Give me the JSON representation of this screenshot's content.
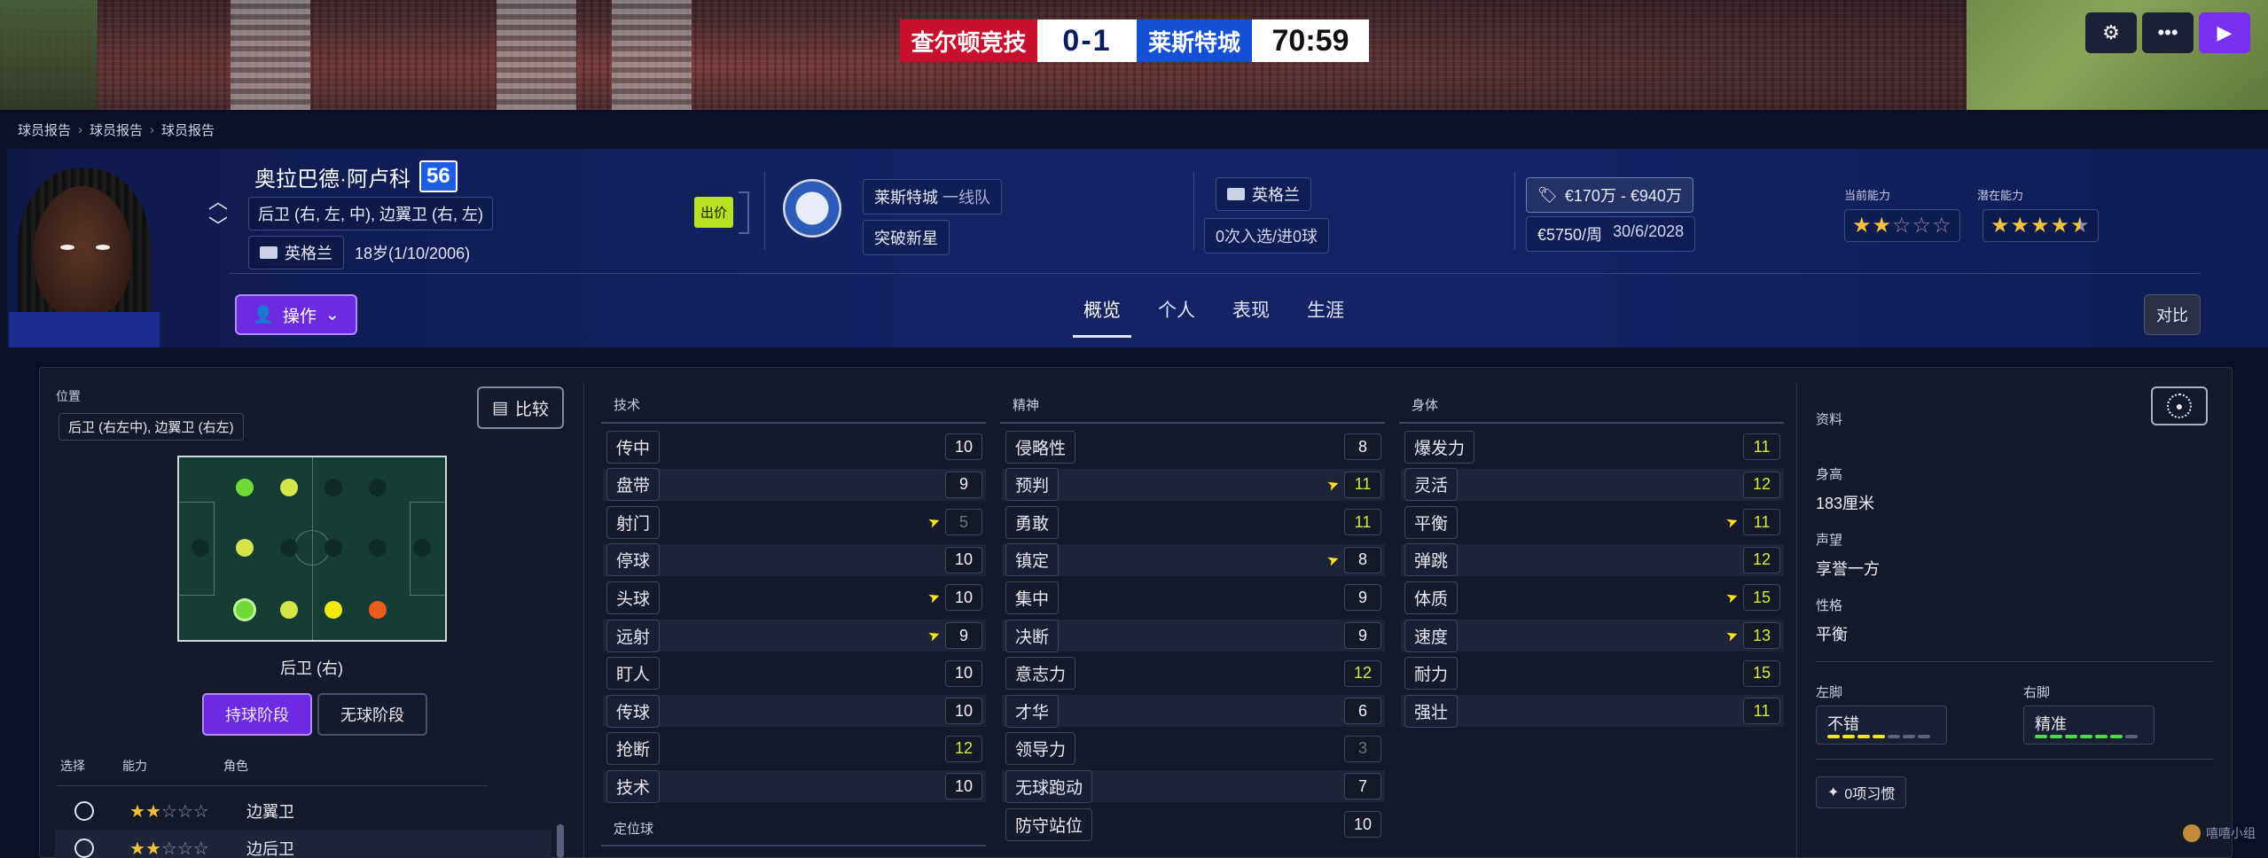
{
  "match": {
    "home_team": "查尔顿竞技",
    "score": "0-1",
    "away_team": "莱斯特城",
    "time": "70:59",
    "home_color": "#c8102e",
    "away_color": "#1450d6"
  },
  "top_buttons": [
    {
      "icon": "gear-icon"
    },
    {
      "icon": "more-icon"
    },
    {
      "icon": "play-icon"
    }
  ],
  "breadcrumb": [
    "球员报告",
    "球员报告",
    "球员报告"
  ],
  "player": {
    "name": "奥拉巴德·阿卢科",
    "rating": "56",
    "positions": "后卫 (右, 左, 中), 边翼卫 (右, 左)",
    "nationality": "英格兰",
    "age_dob": "18岁(1/10/2006)",
    "sale_tag": "出价",
    "club": "莱斯特城",
    "squad": "一线队",
    "role_tag": "突破新星",
    "intl_nation": "英格兰",
    "intl_caps": "0次入选/进0球",
    "value": "€170万 - €940万",
    "wage": "€5750/周",
    "contract_end": "30/6/2028",
    "current_ability_label": "当前能力",
    "potential_ability_label": "潜在能力",
    "current_ability_stars": 2,
    "potential_ability_stars": 4.5
  },
  "actions": {
    "action_label": "操作",
    "compare_top_label": "对比"
  },
  "tabs": [
    {
      "label": "概览",
      "active": true
    },
    {
      "label": "个人",
      "active": false
    },
    {
      "label": "表现",
      "active": false
    },
    {
      "label": "生涯",
      "active": false
    }
  ],
  "position_panel": {
    "title": "位置",
    "positions_chip": "后卫 (右左中), 边翼卫 (右左)",
    "compare_label": "比较",
    "selected_position": "后卫 (右)",
    "phase_in_possession": "持球阶段",
    "phase_out_possession": "无球阶段",
    "role_headers": [
      "选择",
      "能力",
      "角色"
    ],
    "roles": [
      {
        "name": "边翼卫",
        "stars": 2
      },
      {
        "name": "边后卫",
        "stars": 2
      }
    ]
  },
  "technical": {
    "title": "技术",
    "attrs": [
      {
        "name": "传中",
        "value": "10",
        "tone": "white"
      },
      {
        "name": "盘带",
        "value": "9",
        "tone": "white"
      },
      {
        "name": "射门",
        "value": "5",
        "tone": "dim",
        "trend": "arrow-icon"
      },
      {
        "name": "停球",
        "value": "10",
        "tone": "white"
      },
      {
        "name": "头球",
        "value": "10",
        "tone": "white",
        "trend": "arrow-icon"
      },
      {
        "name": "远射",
        "value": "9",
        "tone": "white",
        "trend": "arrow-icon"
      },
      {
        "name": "盯人",
        "value": "10",
        "tone": "white"
      },
      {
        "name": "传球",
        "value": "10",
        "tone": "white"
      },
      {
        "name": "抢断",
        "value": "12",
        "tone": "yellow"
      },
      {
        "name": "技术",
        "value": "10",
        "tone": "white"
      }
    ],
    "setpiece_title": "定位球"
  },
  "mental": {
    "title": "精神",
    "attrs": [
      {
        "name": "侵略性",
        "value": "8",
        "tone": "white"
      },
      {
        "name": "预判",
        "value": "11",
        "tone": "yellow",
        "trend": "arrow-icon"
      },
      {
        "name": "勇敢",
        "value": "11",
        "tone": "yellow"
      },
      {
        "name": "镇定",
        "value": "8",
        "tone": "white",
        "trend": "arrow-icon"
      },
      {
        "name": "集中",
        "value": "9",
        "tone": "white"
      },
      {
        "name": "决断",
        "value": "9",
        "tone": "white"
      },
      {
        "name": "意志力",
        "value": "12",
        "tone": "yellow"
      },
      {
        "name": "才华",
        "value": "6",
        "tone": "white"
      },
      {
        "name": "领导力",
        "value": "3",
        "tone": "dim"
      },
      {
        "name": "无球跑动",
        "value": "7",
        "tone": "white"
      },
      {
        "name": "防守站位",
        "value": "10",
        "tone": "white"
      }
    ]
  },
  "physical": {
    "title": "身体",
    "attrs": [
      {
        "name": "爆发力",
        "value": "11",
        "tone": "yellow"
      },
      {
        "name": "灵活",
        "value": "12",
        "tone": "yellow"
      },
      {
        "name": "平衡",
        "value": "11",
        "tone": "yellow",
        "trend": "arrow-icon"
      },
      {
        "name": "弹跳",
        "value": "12",
        "tone": "yellow"
      },
      {
        "name": "体质",
        "value": "15",
        "tone": "yellow",
        "trend": "arrow-icon"
      },
      {
        "name": "速度",
        "value": "13",
        "tone": "yellow",
        "trend": "arrow-icon"
      },
      {
        "name": "耐力",
        "value": "15",
        "tone": "yellow"
      },
      {
        "name": "强壮",
        "value": "11",
        "tone": "yellow"
      }
    ]
  },
  "info": {
    "title": "资料",
    "height_label": "身高",
    "height_value": "183厘米",
    "reputation_label": "声望",
    "reputation_value": "享誉一方",
    "personality_label": "性格",
    "personality_value": "平衡",
    "left_foot_label": "左脚",
    "left_foot_value": "不错",
    "left_foot_level": 4,
    "right_foot_label": "右脚",
    "right_foot_value": "精准",
    "right_foot_level": 6,
    "habits": "0项习惯"
  },
  "watermark": "嘻嘻小组"
}
